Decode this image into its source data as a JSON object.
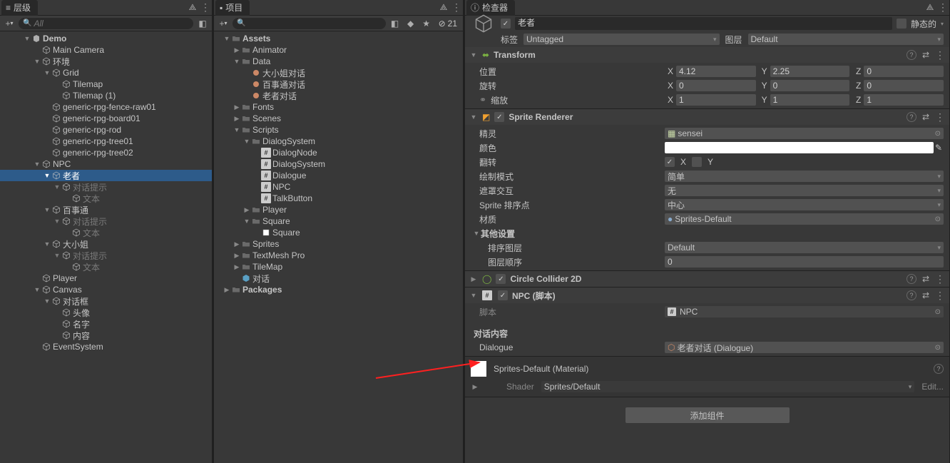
{
  "hierarchy": {
    "title": "层级",
    "search_placeholder": "All",
    "tree": [
      {
        "d": 0,
        "exp": true,
        "ico": "unity",
        "t": "Demo",
        "bold": true
      },
      {
        "d": 1,
        "ico": "cube",
        "t": "Main Camera"
      },
      {
        "d": 1,
        "exp": true,
        "ico": "cube",
        "t": "环境"
      },
      {
        "d": 2,
        "exp": true,
        "ico": "cube",
        "t": "Grid"
      },
      {
        "d": 3,
        "ico": "cube",
        "t": "Tilemap"
      },
      {
        "d": 3,
        "ico": "cube",
        "t": "Tilemap (1)"
      },
      {
        "d": 2,
        "ico": "cube",
        "t": "generic-rpg-fence-raw01"
      },
      {
        "d": 2,
        "ico": "cube",
        "t": "generic-rpg-board01"
      },
      {
        "d": 2,
        "ico": "cube",
        "t": "generic-rpg-rod"
      },
      {
        "d": 2,
        "ico": "cube",
        "t": "generic-rpg-tree01"
      },
      {
        "d": 2,
        "ico": "cube",
        "t": "generic-rpg-tree02"
      },
      {
        "d": 1,
        "exp": true,
        "ico": "cube",
        "t": "NPC"
      },
      {
        "d": 2,
        "exp": true,
        "ico": "cube",
        "t": "老者",
        "sel": true
      },
      {
        "d": 3,
        "exp": true,
        "ico": "cube",
        "t": "对话提示",
        "dim": true
      },
      {
        "d": 4,
        "ico": "cube",
        "t": "文本",
        "dim": true
      },
      {
        "d": 2,
        "exp": true,
        "ico": "cube",
        "t": "百事通"
      },
      {
        "d": 3,
        "exp": true,
        "ico": "cube",
        "t": "对话提示",
        "dim": true
      },
      {
        "d": 4,
        "ico": "cube",
        "t": "文本",
        "dim": true
      },
      {
        "d": 2,
        "exp": true,
        "ico": "cube",
        "t": "大小姐"
      },
      {
        "d": 3,
        "exp": true,
        "ico": "cube",
        "t": "对话提示",
        "dim": true
      },
      {
        "d": 4,
        "ico": "cube",
        "t": "文本",
        "dim": true
      },
      {
        "d": 1,
        "ico": "cube",
        "t": "Player"
      },
      {
        "d": 1,
        "exp": true,
        "ico": "cube",
        "t": "Canvas"
      },
      {
        "d": 2,
        "exp": true,
        "ico": "cube",
        "t": "对话框"
      },
      {
        "d": 3,
        "ico": "cube",
        "t": "头像"
      },
      {
        "d": 3,
        "ico": "cube",
        "t": "名字"
      },
      {
        "d": 3,
        "ico": "cube",
        "t": "内容"
      },
      {
        "d": 1,
        "ico": "cube",
        "t": "EventSystem"
      }
    ]
  },
  "project": {
    "title": "项目",
    "visible_count": "21",
    "tree": [
      {
        "d": 0,
        "exp": true,
        "ico": "folder",
        "t": "Assets",
        "bold": true
      },
      {
        "d": 1,
        "ico": "folder",
        "t": "Animator",
        "arrow": "r"
      },
      {
        "d": 1,
        "exp": true,
        "ico": "folder",
        "t": "Data"
      },
      {
        "d": 2,
        "ico": "asset",
        "t": "大小姐对话"
      },
      {
        "d": 2,
        "ico": "asset",
        "t": "百事通对话"
      },
      {
        "d": 2,
        "ico": "asset",
        "t": "老者对话"
      },
      {
        "d": 1,
        "ico": "folder",
        "t": "Fonts",
        "arrow": "r"
      },
      {
        "d": 1,
        "ico": "folder",
        "t": "Scenes",
        "arrow": "r"
      },
      {
        "d": 1,
        "exp": true,
        "ico": "folder",
        "t": "Scripts"
      },
      {
        "d": 2,
        "exp": true,
        "ico": "folder",
        "t": "DialogSystem"
      },
      {
        "d": 3,
        "ico": "script",
        "t": "DialogNode"
      },
      {
        "d": 3,
        "ico": "script",
        "t": "DialogSystem"
      },
      {
        "d": 3,
        "ico": "script",
        "t": "Dialogue"
      },
      {
        "d": 3,
        "ico": "script",
        "t": "NPC"
      },
      {
        "d": 3,
        "ico": "script",
        "t": "TalkButton"
      },
      {
        "d": 2,
        "ico": "folder",
        "t": "Player",
        "arrow": "r"
      },
      {
        "d": 2,
        "exp": true,
        "ico": "folder",
        "t": "Square"
      },
      {
        "d": 3,
        "ico": "sprite",
        "t": "Square"
      },
      {
        "d": 1,
        "ico": "folder",
        "t": "Sprites",
        "arrow": "r"
      },
      {
        "d": 1,
        "ico": "folder",
        "t": "TextMesh Pro",
        "arrow": "r"
      },
      {
        "d": 1,
        "ico": "folder",
        "t": "TileMap",
        "arrow": "r"
      },
      {
        "d": 1,
        "ico": "prefab",
        "t": "对话"
      },
      {
        "d": 0,
        "ico": "folder",
        "t": "Packages",
        "bold": true,
        "arrow": "r"
      }
    ]
  },
  "inspector": {
    "title": "检查器",
    "name": "老者",
    "static_label": "静态的",
    "tag_label": "标签",
    "tag_value": "Untagged",
    "layer_label": "图层",
    "layer_value": "Default",
    "transform": {
      "title": "Transform",
      "pos_label": "位置",
      "pos": {
        "x": "4.12",
        "y": "2.25",
        "z": "0"
      },
      "rot_label": "旋转",
      "rot": {
        "x": "0",
        "y": "0",
        "z": "0"
      },
      "scale_label": "缩放",
      "scale": {
        "x": "1",
        "y": "1",
        "z": "1"
      }
    },
    "sprite_renderer": {
      "title": "Sprite Renderer",
      "sprite_label": "精灵",
      "sprite_value": "sensei",
      "color_label": "颜色",
      "flip_label": "翻转",
      "flip_x": true,
      "flip_y": false,
      "drawmode_label": "绘制模式",
      "drawmode_value": "简单",
      "mask_label": "遮罩交互",
      "mask_value": "无",
      "sortpoint_label": "Sprite 排序点",
      "sortpoint_value": "中心",
      "material_label": "材质",
      "material_value": "Sprites-Default",
      "other_label": "其他设置",
      "sortlayer_label": "排序图层",
      "sortlayer_value": "Default",
      "order_label": "图层顺序",
      "order_value": "0"
    },
    "circle_collider": {
      "title": "Circle Collider 2D"
    },
    "npc_script": {
      "title": "NPC   (脚本)",
      "script_label": "脚本",
      "script_value": "NPC",
      "content_label": "对话内容",
      "dialogue_label": "Dialogue",
      "dialogue_value": "老者对话 (Dialogue)"
    },
    "material": {
      "title": "Sprites-Default (Material)",
      "shader_label": "Shader",
      "shader_value": "Sprites/Default",
      "edit": "Edit..."
    },
    "add_component": "添加组件"
  }
}
